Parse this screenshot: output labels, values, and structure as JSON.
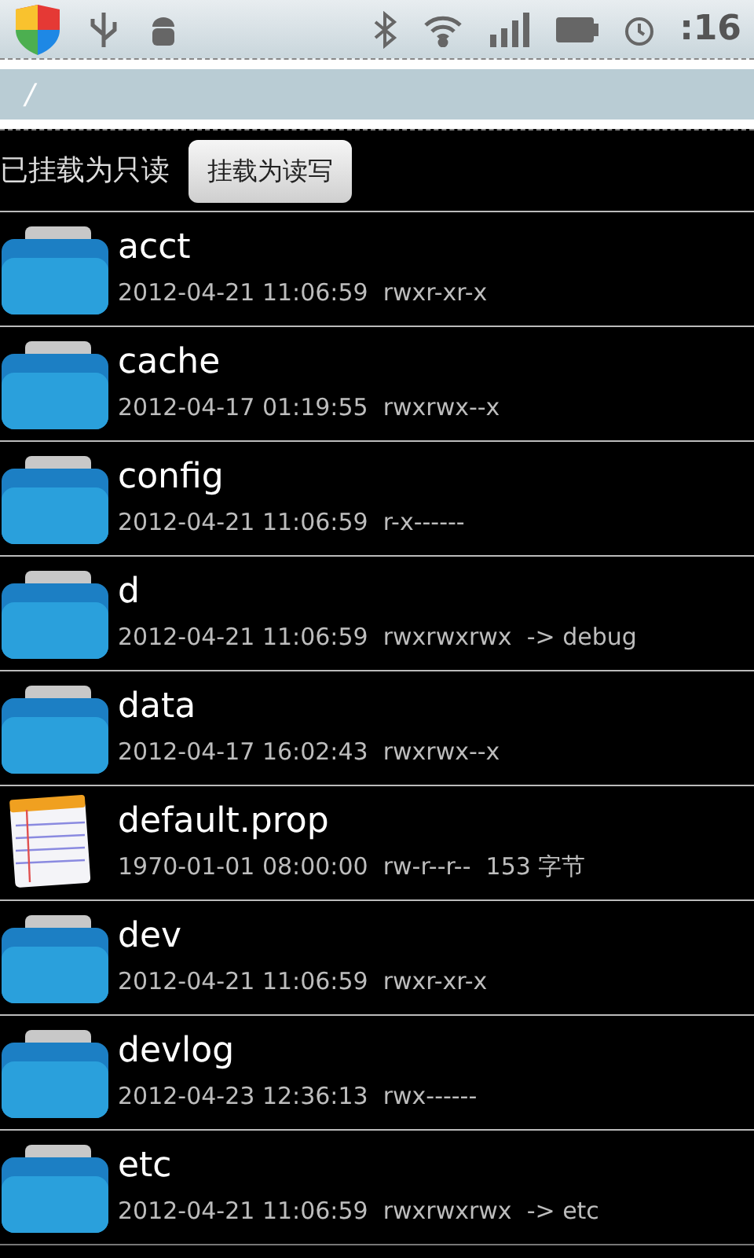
{
  "status_bar": {
    "time": ":16"
  },
  "path": "/",
  "mount": {
    "status": "已挂载为只读",
    "button": "挂载为读写"
  },
  "files": [
    {
      "kind": "folder",
      "name": "acct",
      "details": "2012-04-21 11:06:59  rwxr-xr-x"
    },
    {
      "kind": "folder",
      "name": "cache",
      "details": "2012-04-17 01:19:55  rwxrwx--x"
    },
    {
      "kind": "folder",
      "name": "config",
      "details": "2012-04-21 11:06:59  r-x------"
    },
    {
      "kind": "folder",
      "name": "d",
      "details": "2012-04-21 11:06:59  rwxrwxrwx  -> debug"
    },
    {
      "kind": "folder",
      "name": "data",
      "details": "2012-04-17 16:02:43  rwxrwx--x"
    },
    {
      "kind": "file",
      "name": "default.prop",
      "details": "1970-01-01 08:00:00  rw-r--r--  153 字节"
    },
    {
      "kind": "folder",
      "name": "dev",
      "details": "2012-04-21 11:06:59  rwxr-xr-x"
    },
    {
      "kind": "folder",
      "name": "devlog",
      "details": "2012-04-23 12:36:13  rwx------"
    },
    {
      "kind": "folder",
      "name": "etc",
      "details": "2012-04-21 11:06:59  rwxrwxrwx  -> etc"
    }
  ]
}
